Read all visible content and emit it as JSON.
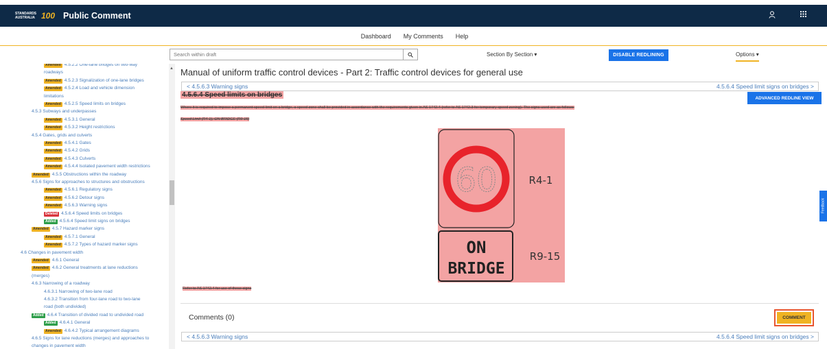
{
  "header": {
    "logo_text": "STANDARDS AUSTRALIA",
    "logo_number": "100",
    "app_title": "Public Comment"
  },
  "nav": {
    "items": [
      "Dashboard",
      "My Comments",
      "Help"
    ]
  },
  "toolbar": {
    "search_placeholder": "Search within draft",
    "section_select": "Section By Section ▾",
    "redline_button": "DISABLE REDLINING",
    "options": "Options ▾"
  },
  "sidebar": {
    "items": [
      {
        "badge": "Amended",
        "text": "4.5.2.2 One-lane bridges on two-way"
      },
      {
        "badge": "",
        "text": "roadways"
      },
      {
        "badge": "Amended",
        "text": "4.5.2.3 Signalization of one-lane bridges"
      },
      {
        "badge": "Amended",
        "text": "4.5.2.4 Load and vehicle dimension"
      },
      {
        "badge": "",
        "text": "limitations"
      },
      {
        "badge": "Amended",
        "text": "4.5.2.5 Speed limits on bridges"
      },
      {
        "badge": "",
        "text": "4.5.3 Subways and underpasses"
      },
      {
        "badge": "Amended",
        "text": "4.5.3.1 General"
      },
      {
        "badge": "Amended",
        "text": "4.5.3.2 Height restrictions"
      },
      {
        "badge": "",
        "text": "4.5.4 Gates, grids and culverts"
      },
      {
        "badge": "Amended",
        "text": "4.5.4.1 Gates"
      },
      {
        "badge": "Amended",
        "text": "4.5.4.2 Grids"
      },
      {
        "badge": "Amended",
        "text": "4.5.4.3 Culverts"
      },
      {
        "badge": "Amended",
        "text": "4.5.4.4 Isolated pavement width restrictions"
      },
      {
        "badge": "Amended",
        "text": "4.5.5 Obstructions within the roadway"
      },
      {
        "badge": "",
        "text": "4.5.6 Signs for approaches to structures and obstructions"
      },
      {
        "badge": "Amended",
        "text": "4.5.6.1 Regulatory signs"
      },
      {
        "badge": "Amended",
        "text": "4.5.6.2 Detour signs"
      },
      {
        "badge": "Amended",
        "text": "4.5.6.3 Warning signs"
      },
      {
        "badge": "Deleted",
        "text": "4.5.6.4 Speed limits on bridges"
      },
      {
        "badge": "Added",
        "text": "4.5.6.4 Speed limit signs on bridges"
      },
      {
        "badge": "Amended",
        "text": "4.5.7 Hazard marker signs"
      },
      {
        "badge": "Amended",
        "text": "4.5.7.1 General"
      },
      {
        "badge": "Amended",
        "text": "4.5.7.2 Types of hazard marker signs"
      },
      {
        "badge": "",
        "text": "4.6 Changes in pavement width"
      },
      {
        "badge": "Amended",
        "text": "4.6.1 General"
      },
      {
        "badge": "Amended",
        "text": "4.6.2 General treatments at lane reductions"
      },
      {
        "badge": "",
        "text": "(merges)"
      },
      {
        "badge": "",
        "text": "4.6.3 Narrowing of a roadway"
      },
      {
        "badge": "",
        "text": "4.6.3.1 Narrowing of two-lane road"
      },
      {
        "badge": "",
        "text": "4.6.3.2 Transition from four-lane road to two-lane"
      },
      {
        "badge": "",
        "text": "road (both undivided)"
      },
      {
        "badge": "Added",
        "text": "4.6.4 Transition of divided road to undivided road"
      },
      {
        "badge": "Added",
        "text": "4.6.4.1 General"
      },
      {
        "badge": "Amended",
        "text": "4.6.4.2 Typical arrangement diagrams"
      },
      {
        "badge": "",
        "text": "4.6.5 Signs for lane reductions (merges) and approaches to"
      },
      {
        "badge": "",
        "text": "changes in pavement width"
      }
    ]
  },
  "main": {
    "doc_title": "Manual of uniform traffic control devices - Part 2: Traffic control devices for general use",
    "prev_link": "< 4.5.6.3 Warning signs",
    "next_link": "4.5.6.4 Speed limit signs on bridges >",
    "advanced_button": "ADVANCED REDLINE VIEW",
    "section_heading": "4.5.6.4   Speed limits on bridges",
    "deleted_paragraph": "Where it is required to impose a permanent speed limit on a bridge, a speed zone shall be provided in accordance with the requirements given in AS 1742.4 (refer to AS 1742.3 for temporary speed zoning). The signs used are as follows:",
    "deleted_caption": "Speed Limit (R4-1), ON BRIDGE (R9-15)",
    "sign_speed": "60",
    "sign_label_1": "R4-1",
    "sign_on": "ON",
    "sign_bridge": "BRIDGE",
    "sign_label_2": "R9-15",
    "deleted_refer": "Refer to AS 1742.4 for use of these signs",
    "comments_title": "Comments (0)",
    "comment_button": "COMMENT",
    "feedback_tab": "Feedback"
  },
  "colors": {
    "header_bg": "#0e2a47",
    "accent": "#f0b323",
    "primary_button": "#1a73e8",
    "deleted_highlight": "#f3a3a3",
    "link": "#4a7ebb"
  }
}
